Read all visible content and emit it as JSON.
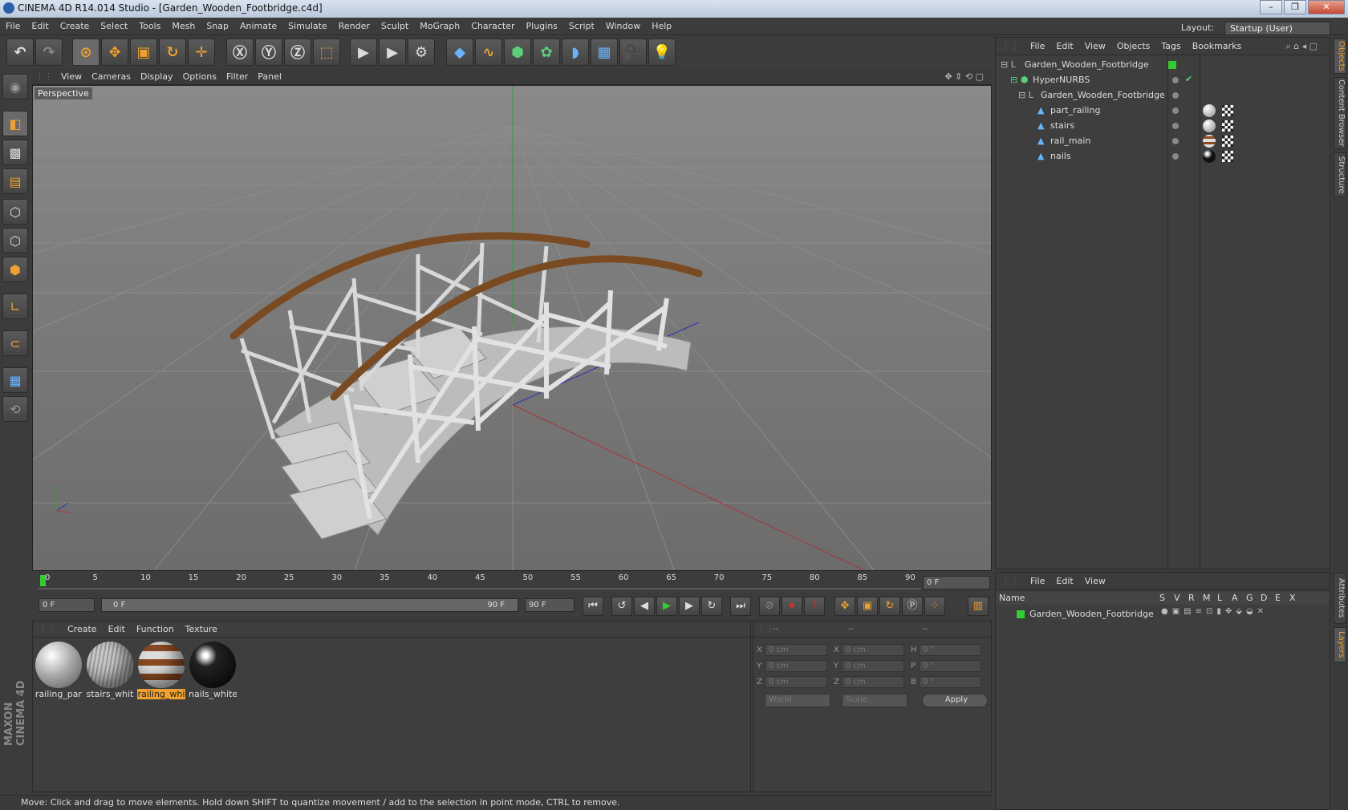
{
  "window": {
    "title": "CINEMA 4D R14.014 Studio - [Garden_Wooden_Footbridge.c4d]",
    "min": "–",
    "max": "❐",
    "close": "✕"
  },
  "menu": [
    "File",
    "Edit",
    "Create",
    "Select",
    "Tools",
    "Mesh",
    "Snap",
    "Animate",
    "Simulate",
    "Render",
    "Sculpt",
    "MoGraph",
    "Character",
    "Plugins",
    "Script",
    "Window",
    "Help"
  ],
  "layout": {
    "label": "Layout:",
    "value": "Startup (User)"
  },
  "viewport": {
    "menu": [
      "View",
      "Cameras",
      "Display",
      "Options",
      "Filter",
      "Panel"
    ],
    "label": "Perspective"
  },
  "timeline": {
    "ticks": [
      "0",
      "5",
      "10",
      "15",
      "20",
      "25",
      "30",
      "35",
      "40",
      "45",
      "50",
      "55",
      "60",
      "65",
      "70",
      "75",
      "80",
      "85",
      "90"
    ],
    "frame_field": "0 F"
  },
  "transport": {
    "start": "0 F",
    "range_start": "0 F",
    "range_end": "90 F",
    "end": "90 F"
  },
  "materials": {
    "menu": [
      "Create",
      "Edit",
      "Function",
      "Texture"
    ],
    "items": [
      {
        "label": "railing_par",
        "selected": false
      },
      {
        "label": "stairs_whit",
        "selected": false
      },
      {
        "label": "railing_whi",
        "selected": true
      },
      {
        "label": "nails_white",
        "selected": false
      }
    ]
  },
  "coords": {
    "headers": [
      "--",
      "--",
      "--"
    ],
    "rows": [
      {
        "a": "X",
        "av": "0 cm",
        "b": "X",
        "bv": "0 cm",
        "c": "H",
        "cv": "0 °"
      },
      {
        "a": "Y",
        "av": "0 cm",
        "b": "Y",
        "bv": "0 cm",
        "c": "P",
        "cv": "0 °"
      },
      {
        "a": "Z",
        "av": "0 cm",
        "b": "Z",
        "bv": "0 cm",
        "c": "B",
        "cv": "0 °"
      }
    ],
    "space": "World",
    "mode": "Scale",
    "apply": "Apply"
  },
  "status": "Move: Click and drag to move elements. Hold down SHIFT to quantize movement / add to the selection in point mode, CTRL to remove.",
  "objects": {
    "menu": [
      "File",
      "Edit",
      "View",
      "Objects",
      "Tags",
      "Bookmarks"
    ],
    "tree": [
      {
        "name": "Garden_Wooden_Footbridge",
        "indent": 0
      },
      {
        "name": "HyperNURBS",
        "indent": 1
      },
      {
        "name": "Garden_Wooden_Footbridge",
        "indent": 2
      },
      {
        "name": "part_railing",
        "indent": 3
      },
      {
        "name": "stairs",
        "indent": 3
      },
      {
        "name": "rail_main",
        "indent": 3
      },
      {
        "name": "nails",
        "indent": 3
      }
    ]
  },
  "layers": {
    "menu": [
      "File",
      "Edit",
      "View"
    ],
    "columns": [
      "Name",
      "S",
      "V",
      "R",
      "M",
      "L",
      "A",
      "G",
      "D",
      "E",
      "X"
    ],
    "rows": [
      {
        "name": "Garden_Wooden_Footbridge"
      }
    ]
  },
  "sidetabs": [
    "Objects",
    "Content Browser",
    "Structure",
    "Attributes",
    "Layers"
  ],
  "brand": "MAXON CINEMA 4D",
  "colors": {
    "accent": "#f0a030",
    "background": "#3c3c3c",
    "layer_green": "#33cc33"
  }
}
